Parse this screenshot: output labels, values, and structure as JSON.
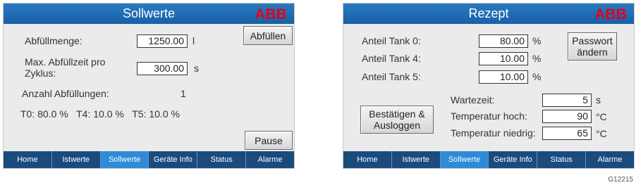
{
  "left": {
    "title": "Sollwerte",
    "fill_amount_label": "Abfüllmenge:",
    "fill_amount_value": "1250.00",
    "fill_amount_unit": "l",
    "max_fill_time_label": "Max. Abfüllzeit pro Zyklus:",
    "max_fill_time_value": "300.00",
    "max_fill_time_unit": "s",
    "fill_count_label": "Anzahl Abfüllungen:",
    "fill_count_value": "1",
    "tank_shares": "T0: 80.0 %   T4: 10.0 %   T5: 10.0 %",
    "fill_button": "Abfüllen",
    "pause_button": "Pause",
    "tabs": [
      "Home",
      "Istwerte",
      "Sollwerte",
      "Geräte Info",
      "Status",
      "Alarme"
    ],
    "active_tab": "Sollwerte"
  },
  "right": {
    "title": "Rezept",
    "tanks": [
      {
        "label": "Anteil Tank 0:",
        "value": "80.00",
        "unit": "%"
      },
      {
        "label": "Anteil Tank 4:",
        "value": "10.00",
        "unit": "%"
      },
      {
        "label": "Anteil Tank 5:",
        "value": "10.00",
        "unit": "%"
      }
    ],
    "password_button": "Passwort ändern",
    "confirm_button": "Bestätigen & Ausloggen",
    "params": [
      {
        "label": "Wartezeit:",
        "value": "5",
        "unit": "s"
      },
      {
        "label": "Temperatur hoch:",
        "value": "90",
        "unit": "°C"
      },
      {
        "label": "Temperatur niedrig:",
        "value": "65",
        "unit": "°C"
      }
    ],
    "tabs": [
      "Home",
      "Istwerte",
      "Sollwerte",
      "Geräte Info",
      "Status",
      "Alarme"
    ],
    "active_tab": "Sollwerte"
  },
  "logo_text": "ABB",
  "colors": {
    "header": "#1d68b0",
    "nav": "#1a4b7e",
    "active_tab": "#2f8bd8",
    "logo": "#e2001a"
  },
  "figure_id": "G12215"
}
